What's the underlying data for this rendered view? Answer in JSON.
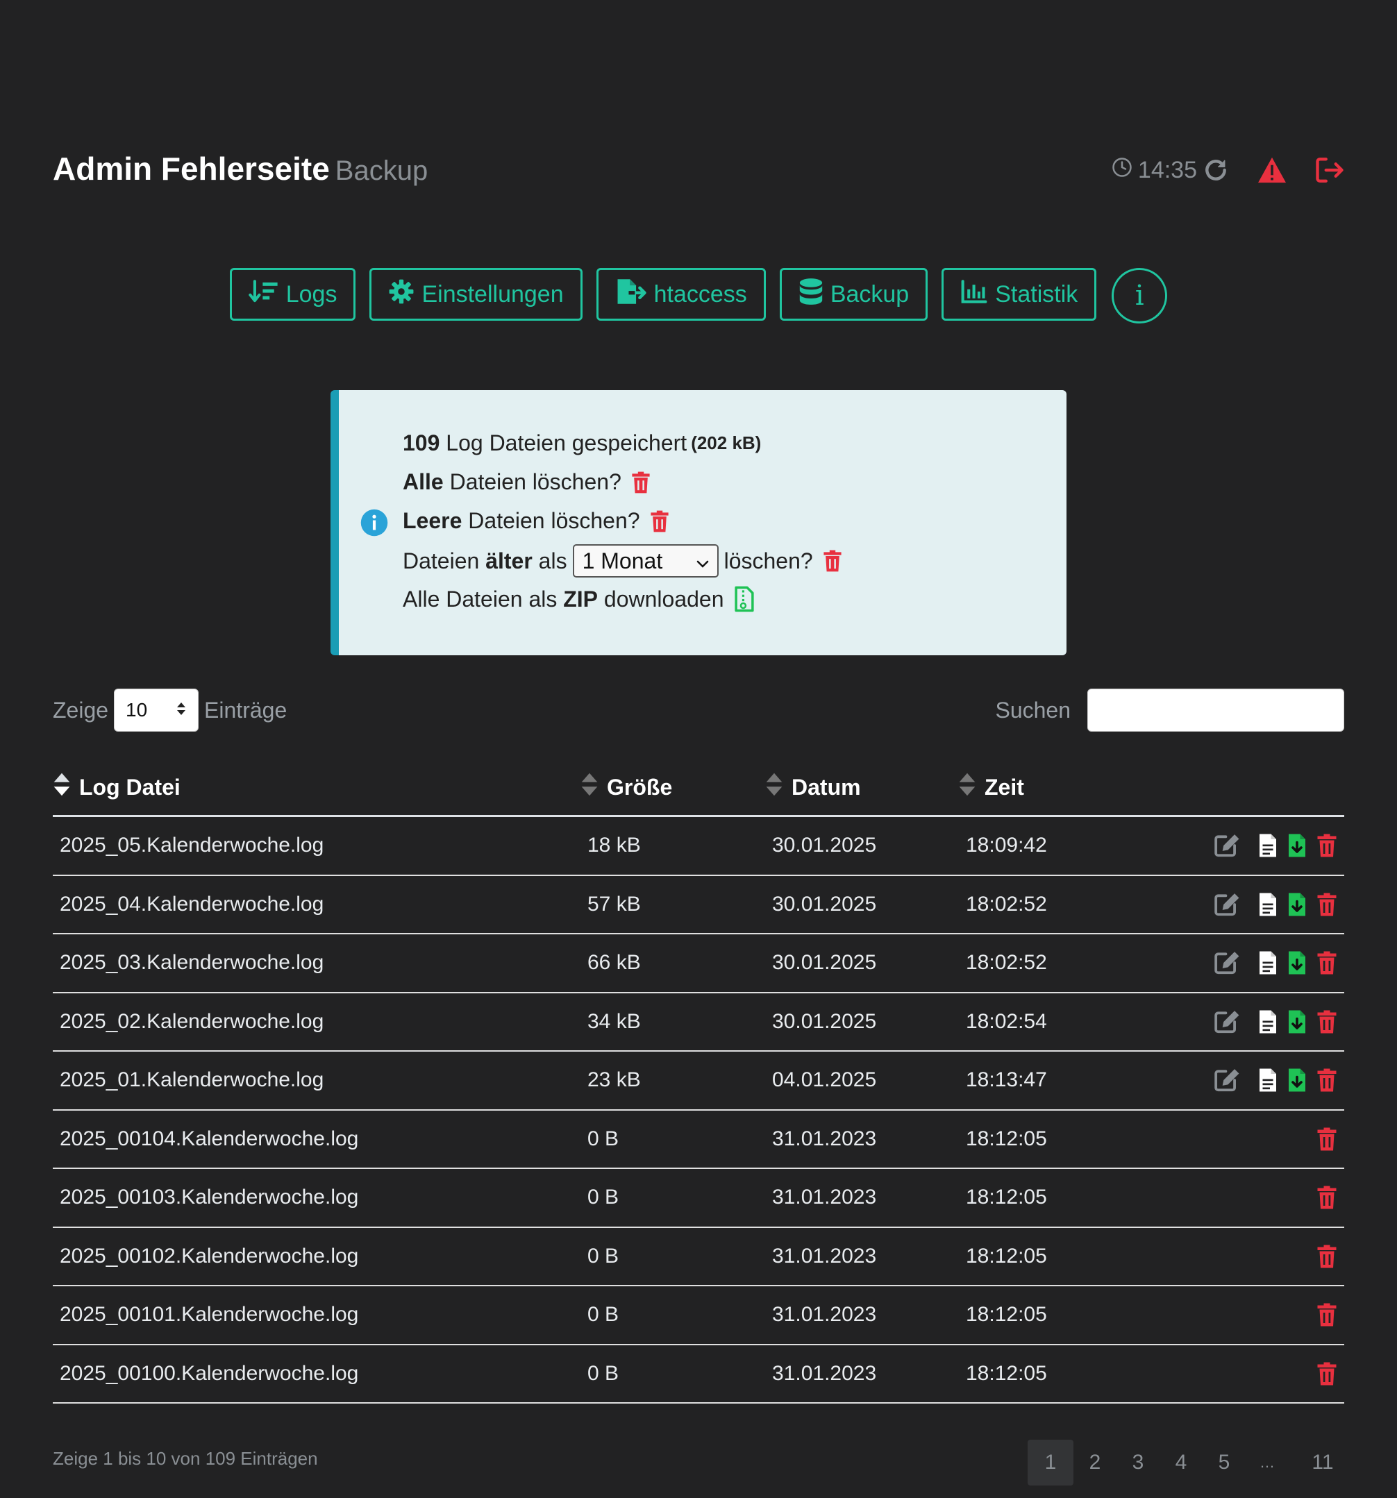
{
  "header": {
    "title": "Admin Fehlerseite",
    "subtitle": "Backup",
    "time": "14:35",
    "colors": {
      "accent": "#20c5a0",
      "danger": "#e8303f",
      "success": "#1fc255",
      "info": "#1a9db5"
    }
  },
  "nav": {
    "logs": "Logs",
    "settings": "Einstellungen",
    "htaccess": "htaccess",
    "backup": "Backup",
    "stats": "Statistik",
    "info": "i"
  },
  "info": {
    "count": "109",
    "count_text": "Log Dateien gespeichert",
    "size": "(202 kB)",
    "delete_all_bold": "Alle",
    "delete_all_text": "Dateien löschen?",
    "delete_empty_bold": "Leere",
    "delete_empty_text": "Dateien löschen?",
    "older_pre": "Dateien",
    "older_bold": "älter",
    "older_mid": "als",
    "older_select": "1 Monat",
    "older_post": "löschen?",
    "zip_pre": "Alle Dateien als",
    "zip_bold": "ZIP",
    "zip_post": "downloaden"
  },
  "controls": {
    "show": "Zeige",
    "page_length": "10",
    "entries": "Einträge",
    "search_label": "Suchen",
    "search_value": ""
  },
  "table": {
    "headers": {
      "file": "Log Datei",
      "size": "Größe",
      "date": "Datum",
      "time": "Zeit"
    },
    "rows": [
      {
        "file": "2025_05.Kalenderwoche.log",
        "size": "18 kB",
        "date": "30.01.2025",
        "time": "18:09:42"
      },
      {
        "file": "2025_04.Kalenderwoche.log",
        "size": "57 kB",
        "date": "30.01.2025",
        "time": "18:02:52"
      },
      {
        "file": "2025_03.Kalenderwoche.log",
        "size": "66 kB",
        "date": "30.01.2025",
        "time": "18:02:52"
      },
      {
        "file": "2025_02.Kalenderwoche.log",
        "size": "34 kB",
        "date": "30.01.2025",
        "time": "18:02:54"
      },
      {
        "file": "2025_01.Kalenderwoche.log",
        "size": "23 kB",
        "date": "04.01.2025",
        "time": "18:13:47"
      },
      {
        "file": "2025_00104.Kalenderwoche.log",
        "size": "0 B",
        "date": "31.01.2023",
        "time": "18:12:05"
      },
      {
        "file": "2025_00103.Kalenderwoche.log",
        "size": "0 B",
        "date": "31.01.2023",
        "time": "18:12:05"
      },
      {
        "file": "2025_00102.Kalenderwoche.log",
        "size": "0 B",
        "date": "31.01.2023",
        "time": "18:12:05"
      },
      {
        "file": "2025_00101.Kalenderwoche.log",
        "size": "0 B",
        "date": "31.01.2023",
        "time": "18:12:05"
      },
      {
        "file": "2025_00100.Kalenderwoche.log",
        "size": "0 B",
        "date": "31.01.2023",
        "time": "18:12:05"
      }
    ]
  },
  "footer": {
    "info": "Zeige 1 bis 10 von 109 Einträgen",
    "pages": [
      "1",
      "2",
      "3",
      "4",
      "5",
      "…",
      "11"
    ],
    "current_page": "1"
  }
}
